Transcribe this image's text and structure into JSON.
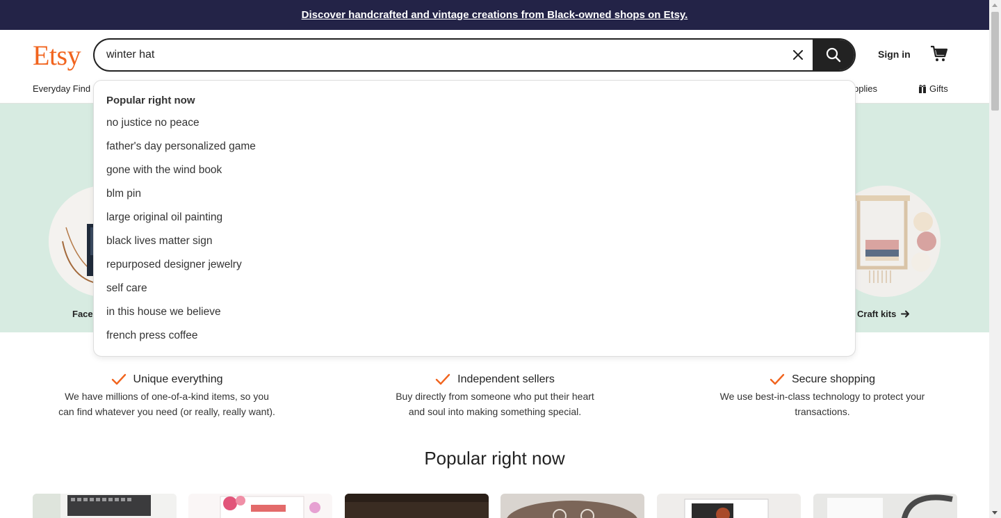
{
  "banner": {
    "text": "Discover handcrafted and vintage creations from Black-owned shops on Etsy."
  },
  "header": {
    "logo": "Etsy",
    "search_value": "winter hat",
    "sign_in": "Sign in"
  },
  "nav": {
    "items": [
      "Everyday Find",
      "pplies",
      "Gifts"
    ]
  },
  "dropdown": {
    "heading": "Popular right now",
    "suggestions": [
      "no justice no peace",
      "father's day personalized game",
      "gone with the wind book",
      "blm pin",
      "large original oil painting",
      "black lives matter sign",
      "repurposed designer jewelry",
      "self care",
      "in this house we believe",
      "french press coffee"
    ]
  },
  "hero": {
    "left_label": "Face",
    "right_label": "Craft kits"
  },
  "features": [
    {
      "title": "Unique everything",
      "desc_line1": "We have millions of one-of-a-kind items, so you",
      "desc_line2": "can find whatever you need (or really, really want)."
    },
    {
      "title": "Independent sellers",
      "desc_line1": "Buy directly from someone who put their heart",
      "desc_line2": "and soul into making something special."
    },
    {
      "title": "Secure shopping",
      "desc_line1": "We use best-in-class technology to protect your",
      "desc_line2": "transactions."
    }
  ],
  "popular_title": "Popular right now",
  "colors": {
    "brand": "#f1641e",
    "banner_bg": "#232347",
    "hero_bg": "#d7ebe1",
    "check": "#f1641e"
  },
  "icons": {
    "clear": "close-icon",
    "search": "search-icon",
    "cart": "cart-icon",
    "gift": "gift-icon",
    "arrow": "arrow-right-icon",
    "check": "check-icon"
  }
}
